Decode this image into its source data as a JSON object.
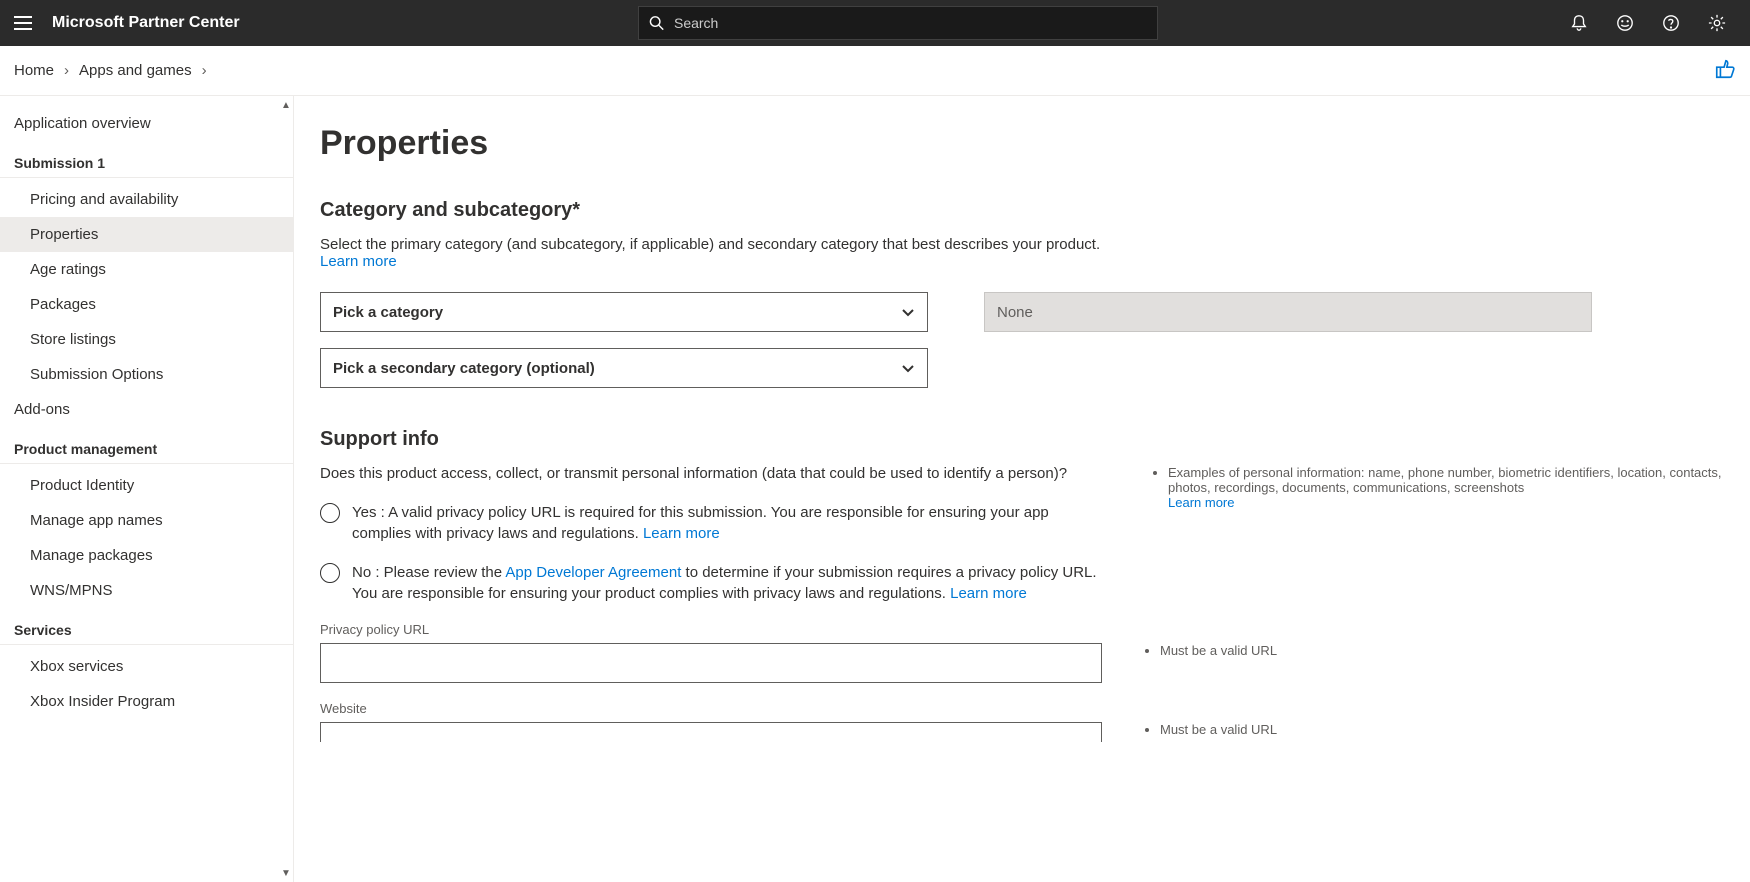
{
  "header": {
    "app_title": "Microsoft Partner Center",
    "search_placeholder": "Search"
  },
  "breadcrumb": {
    "items": [
      "Home",
      "Apps and games"
    ]
  },
  "sidebar": {
    "overview": "Application overview",
    "submission_header": "Submission 1",
    "submission_items": [
      "Pricing and availability",
      "Properties",
      "Age ratings",
      "Packages",
      "Store listings",
      "Submission Options"
    ],
    "addons": "Add-ons",
    "product_mgmt_header": "Product management",
    "product_mgmt_items": [
      "Product Identity",
      "Manage app names",
      "Manage packages",
      "WNS/MPNS"
    ],
    "services_header": "Services",
    "services_items": [
      "Xbox services",
      "Xbox Insider Program"
    ]
  },
  "main": {
    "title": "Properties",
    "category": {
      "heading": "Category and subcategory*",
      "desc": "Select the primary category (and subcategory, if applicable) and secondary category that best describes your product. ",
      "learn_more": "Learn more",
      "primary_placeholder": "Pick a category",
      "secondary_placeholder": "Pick a secondary category (optional)",
      "subcategory_placeholder": "None"
    },
    "support": {
      "heading": "Support info",
      "question": "Does this product access, collect, or transmit personal information (data that could be used to identify a person)?",
      "hint": "Examples of personal information: name, phone number, biometric identifiers, location, contacts, photos, recordings, documents, communications, screenshots",
      "hint_link": "Learn more",
      "yes_pre": "Yes : A valid privacy policy URL is required for this submission. You are responsible for ensuring your app complies with privacy laws and regulations. ",
      "yes_link": "Learn more",
      "no_pre": "No : Please review the ",
      "no_link1": "App Developer Agreement",
      "no_mid": " to determine if your submission requires a privacy policy URL. You are responsible for ensuring your product complies with privacy laws and regulations. ",
      "no_link2": "Learn more",
      "privacy_label": "Privacy policy URL",
      "website_label": "Website",
      "valid_url": "Must be a valid URL"
    }
  }
}
